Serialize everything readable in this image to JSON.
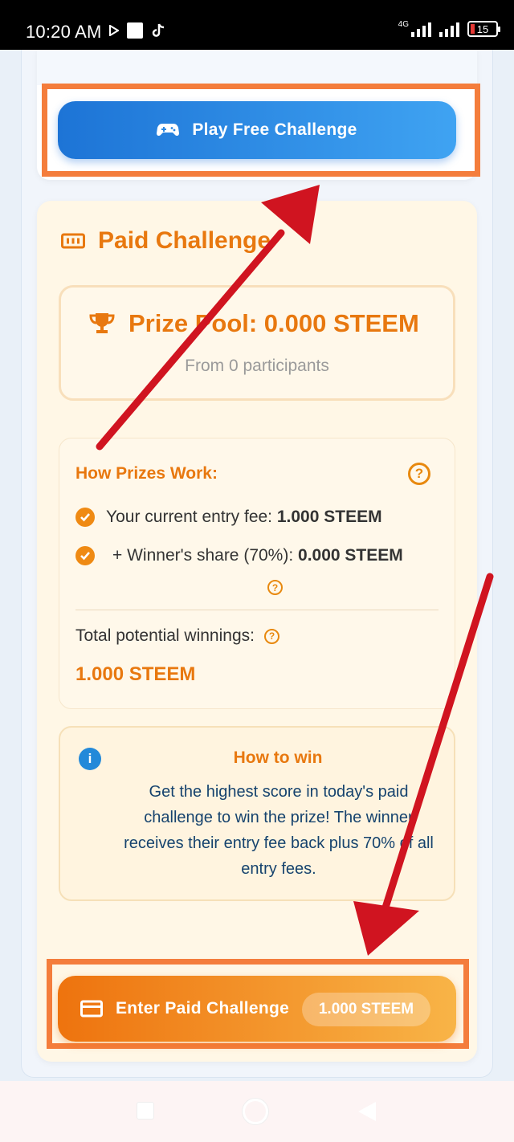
{
  "status_bar": {
    "time": "10:20 AM",
    "network": "4G",
    "battery": "15"
  },
  "free_challenge": {
    "button_label": "Play Free Challenge",
    "icon": "gamepad-icon"
  },
  "paid_challenge": {
    "title": "Paid Challenge",
    "title_icon": "ticket-icon",
    "prize_pool": {
      "label": "Prize Pool: 0.000 STEEM",
      "icon": "trophy-icon",
      "subtitle": "From 0 participants"
    },
    "how_prizes_work": {
      "heading": "How Prizes Work:",
      "entry_fee_label": "Your current entry fee:",
      "entry_fee_value": "1.000 STEEM",
      "winner_share_label": "+ Winner's share (70%):",
      "winner_share_value": "0.000 STEEM",
      "total_label": "Total potential winnings:",
      "total_value": "1.000 STEEM"
    },
    "how_to_win": {
      "heading": "How to win",
      "text": "Get the highest score in today's paid challenge to win the prize! The winner receives their entry fee back plus 70% of all entry fees."
    },
    "enter_button": {
      "label": "Enter Paid Challenge",
      "price": "1.000 STEEM",
      "icon": "credit-card-icon"
    }
  },
  "colors": {
    "accent_orange": "#e8780f",
    "accent_blue": "#1d74d6",
    "highlight_box": "#f47d3c",
    "annotation_arrow": "#d01420"
  }
}
